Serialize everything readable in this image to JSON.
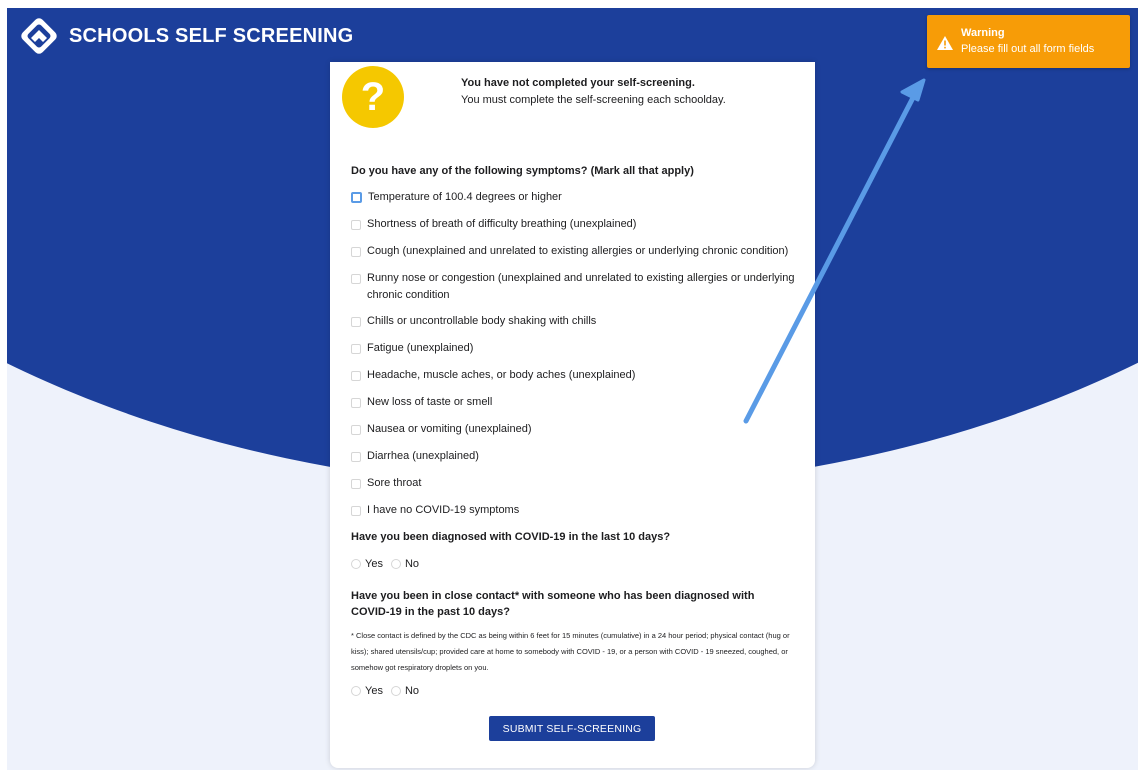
{
  "app": {
    "brand": "SCHOOLS SELF SCREENING"
  },
  "toast": {
    "title": "Warning",
    "message": "Please fill out all form fields",
    "icon": "warning-triangle-icon",
    "color": "#f79c07"
  },
  "notice": {
    "title": "You have not completed your self-screening.",
    "subtitle": "You must complete the self-screening each schoolday.",
    "icon": "question-mark-icon"
  },
  "symptoms": {
    "question": "Do you have any of the following symptoms? (Mark all that apply)",
    "options": [
      "Temperature of 100.4 degrees or higher",
      "Shortness of breath of difficulty breathing (unexplained)",
      "Cough (unexplained and unrelated to existing allergies or underlying chronic condition)",
      "Runny nose or congestion (unexplained and unrelated to existing allergies or underlying chronic condition",
      "Chills or uncontrollable body shaking with chills",
      "Fatigue (unexplained)",
      "Headache, muscle aches, or body aches (unexplained)",
      "New loss of taste or smell",
      "Nausea or vomiting (unexplained)",
      "Diarrhea (unexplained)",
      "Sore throat",
      "I have no COVID-19 symptoms"
    ]
  },
  "diagnosed": {
    "question": "Have you been diagnosed with COVID-19 in the last 10 days?",
    "yes": "Yes",
    "no": "No"
  },
  "contact": {
    "question": "Have you been in close contact* with someone who has been diagnosed with COVID-19 in the past 10 days?",
    "footnote": "* Close contact is defined by the CDC as being within 6 feet for 15 minutes (cumulative) in a 24 hour period; physical contact (hug or kiss); shared utensils/cup; provided care at home to somebody with COVID - 19, or a person with COVID - 19 sneezed, coughed, or somehow got respiratory droplets on you.",
    "yes": "Yes",
    "no": "No"
  },
  "submit": {
    "label": "SUBMIT SELF-SCREENING"
  },
  "colors": {
    "brand": "#1c3f9b",
    "warning": "#f79c07",
    "accent": "#f5c800",
    "annotation": "#5a9be6"
  }
}
